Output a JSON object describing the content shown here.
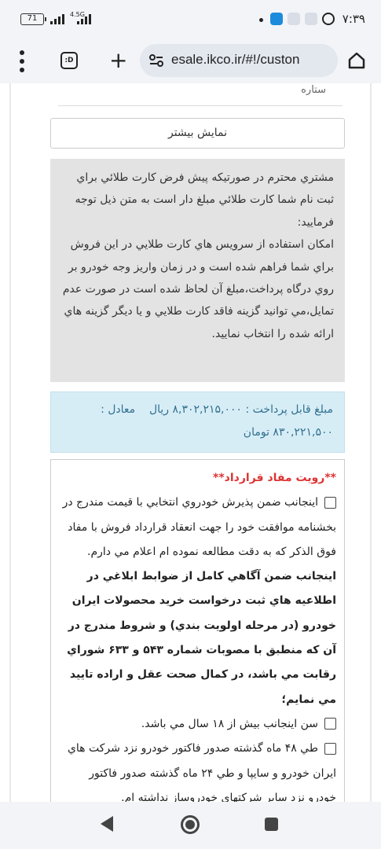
{
  "status_bar": {
    "battery": "71",
    "network": "4.5G",
    "time": "۷:۳۹"
  },
  "browser": {
    "tab_count": ":D",
    "url": "esale.ikco.ir/#!/custon"
  },
  "page": {
    "rating_label": "ستاره",
    "show_more": "نمايش بيشتر",
    "notice": {
      "line1": "مشتري محترم در صورتيکه پيش فرض کارت طلائي براي ثبت نام شما کارت طلائي مبلغ دار است به متن ذيل توجه فرماييد:",
      "line2": "امکان استفاده از سرويس هاي کارت طلايي در اين فروش براي شما فراهم شده است و در زمان واريز وجه خودرو بر روي درگاه پرداخت،مبلغ آن لحاظ شده است در صورت عدم تمايل،مي توانيد گزينه فاقد کارت طلايي و يا ديگر گزينه هاي ارائه شده را انتخاب نماييد."
    },
    "amount": {
      "label": "مبلغ قابل پرداخت :",
      "rial_value": "۸,۳۰۲,۲۱۵,۰۰۰ ريال",
      "equals": "معادل :",
      "toman_value": "۸۳۰,۲۲۱,۵۰۰ تومان"
    },
    "contract": {
      "title": "**رويت مفاد قرارداد**",
      "item1": "اينجانب ضمن پذيرش خودروي انتخابي با قيمت مندرج در بخشنامه موافقت خود را جهت انعقاد قرارداد فروش با مفاد فوق الذکر که به دقت مطالعه نموده ام اعلام مي دارم.",
      "bold_para": "اينجانب ضمن آگاهي کامل از ضوابط ابلاغي در اطلاعيه هاي ثبت درخواست خريد محصولات ايران خودرو (در مرحله اولويت بندي) و شروط مندرج در آن که منطبق با مصوبات شماره ۵۴۳ و ۶۳۳ شوراي رقابت مي باشد، در کمال صحت عقل و اراده تاييد مي نمايم؛",
      "item2": "سن اينجانب بيش از ۱۸ سال مي باشد.",
      "item3": "طي ۴۸ ماه گذشته صدور فاکتور خودرو نزد شرکت هاي ايران خودرو و سايپا و طي ۲۴ ماه گذشته صدور فاکتور خودرو نزد ساير شرکتهاي خودروساز نداشته ام."
    }
  },
  "colors": {
    "notice_bg": "#e3e3e3",
    "amount_bg": "#d7edf6",
    "amount_text": "#31708f",
    "contract_title": "#dd3333"
  }
}
